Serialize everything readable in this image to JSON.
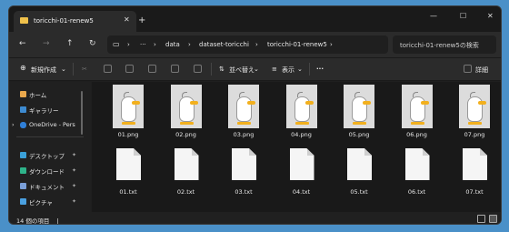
{
  "tab": {
    "title": "toricchi-01-renew5",
    "close": "✕",
    "new_tab": "+"
  },
  "window_controls": {
    "minimize": "—",
    "maximize": "☐",
    "close": "✕"
  },
  "nav": {
    "back": "←",
    "forward": "→",
    "up": "↑",
    "refresh": "↻"
  },
  "address": {
    "monitor": "▭",
    "sep": "›",
    "more": "···",
    "crumbs": [
      "data",
      "dataset-toricchi",
      "toricchi-01-renew5"
    ]
  },
  "search": {
    "placeholder": "toricchi-01-renew5の検索",
    "icon": "⌕"
  },
  "toolbar": {
    "new_label": "新規作成",
    "new_chevron": "⌄",
    "sort_label": "並べ替え",
    "view_label": "表示",
    "more": "···",
    "details_label": "詳細"
  },
  "sidebar": {
    "items": [
      {
        "label": "ホーム",
        "icon": "home-icon"
      },
      {
        "label": "ギャラリー",
        "icon": "gallery-icon"
      },
      {
        "label": "OneDrive - Pers",
        "icon": "onedrive-icon"
      },
      {
        "label": "デスクトップ",
        "icon": "desktop-icon"
      },
      {
        "label": "ダウンロード",
        "icon": "download-icon"
      },
      {
        "label": "ドキュメント",
        "icon": "document-icon"
      },
      {
        "label": "ピクチャ",
        "icon": "pictures-icon"
      }
    ],
    "expand": "›",
    "pin": "✦"
  },
  "files": {
    "images": [
      "01.png",
      "02.png",
      "03.png",
      "04.png",
      "05.png",
      "06.png",
      "07.png"
    ],
    "texts": [
      "01.txt",
      "02.txt",
      "03.txt",
      "04.txt",
      "05.txt",
      "06.txt",
      "07.txt"
    ]
  },
  "status": {
    "count": "14 個の項目",
    "sep": "|"
  },
  "colors": {
    "accent": "#4a90c8",
    "folder": "#f0c14b",
    "beak": "#f2b01e"
  }
}
